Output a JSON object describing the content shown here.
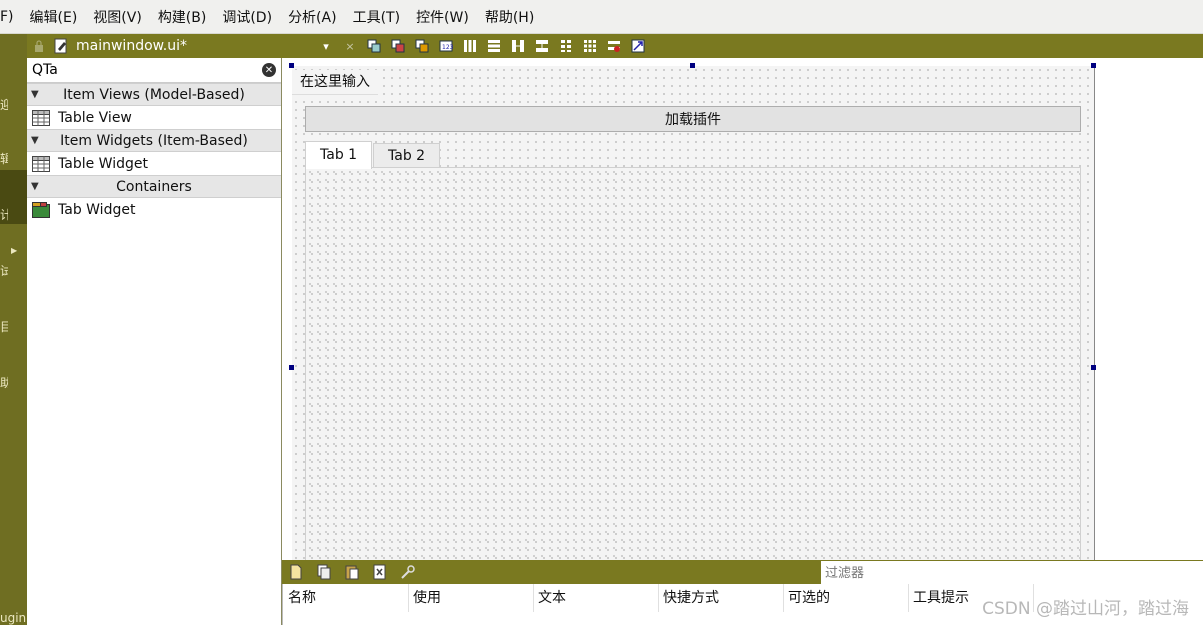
{
  "menubar": {
    "items": [
      "F)",
      "编辑(E)",
      "视图(V)",
      "构建(B)",
      "调试(D)",
      "分析(A)",
      "工具(T)",
      "控件(W)",
      "帮助(H)"
    ]
  },
  "mode_bar": {
    "marks": [
      "迎",
      "辑",
      "计",
      "试",
      "目",
      "助"
    ],
    "bottom_label": "ugin"
  },
  "doc_toolbar": {
    "file_name": "mainwindow.ui*",
    "dropdown_glyph": "▾",
    "close_glyph": "×"
  },
  "widget_box": {
    "filter_value": "QTa",
    "categories": [
      {
        "label": "Item Views (Model-Based)",
        "items": [
          {
            "label": "Table View",
            "icon": "table-icon"
          }
        ]
      },
      {
        "label": "Item Widgets (Item-Based)",
        "items": [
          {
            "label": "Table Widget",
            "icon": "table-icon"
          }
        ]
      },
      {
        "label": "Containers",
        "items": [
          {
            "label": "Tab Widget",
            "icon": "tab-widget-icon"
          }
        ]
      }
    ]
  },
  "form": {
    "menu_placeholder": "在这里输入",
    "load_plugin_button": "加载插件",
    "tabs": [
      "Tab 1",
      "Tab 2"
    ]
  },
  "action_editor": {
    "filter_placeholder": "过滤器",
    "columns": [
      "名称",
      "使用",
      "文本",
      "快捷方式",
      "可选的",
      "工具提示"
    ]
  },
  "watermark": "CSDN @踏过山河，踏过海",
  "colors": {
    "mode_bar": "#6f6e22",
    "toolbar": "#7a7920",
    "selection_handle": "#000080"
  }
}
